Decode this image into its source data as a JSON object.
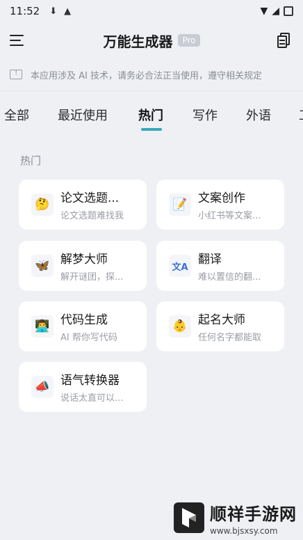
{
  "status_bar": {
    "time": "11:52"
  },
  "header": {
    "title": "万能生成器",
    "badge": "Pro"
  },
  "notice": {
    "text": "本应用涉及 AI 技术，请务必合法正当使用，遵守相关规定"
  },
  "tabs": [
    {
      "label": "全部",
      "active": false
    },
    {
      "label": "最近使用",
      "active": false
    },
    {
      "label": "热门",
      "active": true
    },
    {
      "label": "写作",
      "active": false
    },
    {
      "label": "外语",
      "active": false
    },
    {
      "label": "工",
      "active": false
    }
  ],
  "section": {
    "label": "热门"
  },
  "cards": [
    {
      "icon": "thinking-face-icon",
      "emoji": "🤔",
      "title": "论文选题...",
      "subtitle": "论文选题难找我"
    },
    {
      "icon": "memo-icon",
      "emoji": "📝",
      "title": "文案创作",
      "subtitle": "小红书等文案..."
    },
    {
      "icon": "butterfly-icon",
      "emoji": "🦋",
      "title": "解梦大师",
      "subtitle": "解开谜团，探..."
    },
    {
      "icon": "translate-icon",
      "emoji": "文A",
      "title": "翻译",
      "subtitle": "难以置信的翻..."
    },
    {
      "icon": "technologist-icon",
      "emoji": "👨‍💻",
      "title": "代码生成",
      "subtitle": "AI 帮你写代码"
    },
    {
      "icon": "baby-icon",
      "emoji": "👶",
      "title": "起名大师",
      "subtitle": "任何名字都能取"
    },
    {
      "icon": "megaphone-icon",
      "emoji": "📣",
      "title": "语气转换器",
      "subtitle": "说话太直可以..."
    }
  ],
  "watermark": {
    "name": "顺祥手游网",
    "url": "www.bjsxsy.com"
  },
  "colors": {
    "accent": "#3aa8b6",
    "background": "#eef0f4",
    "card": "#ffffff"
  }
}
